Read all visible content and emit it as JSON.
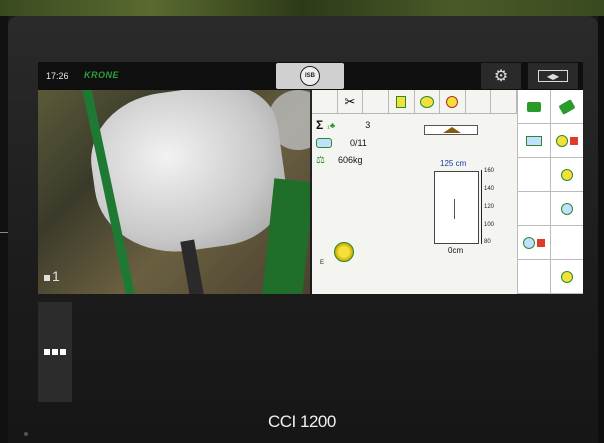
{
  "header": {
    "time": "17:26",
    "brand": "KRONE",
    "isb_label": "ISB",
    "gear_icon": "gear-icon",
    "swap_icon": "swap-screens-icon"
  },
  "camera": {
    "label": "1"
  },
  "isobus": {
    "toolbar": [
      "scissors-icon",
      "net-wrap-icon",
      "bale-counter-a-icon",
      "bale-counter-r-icon",
      "",
      ""
    ],
    "bale_total_label": "Σ",
    "bale_total_value": "3",
    "bale_count": "0/11",
    "weight": "606kg",
    "diameter_label": "125 cm",
    "diameter_ticks": [
      "160",
      "140",
      "120",
      "100",
      "80"
    ],
    "base_label": "0cm",
    "ring_label": "E",
    "colors": {
      "green": "#2a9a2a",
      "yellow": "#f3e13a",
      "red": "#e03a2a",
      "blue": "#1a3aa0"
    }
  },
  "softkeys": [
    "green-block-icon",
    "green-arrow-icon",
    "counter-icon",
    "bale-red-icon",
    "",
    "bale-yellow-icon",
    "",
    "bale-cm-icon",
    "bale-red-2-icon",
    "",
    "",
    "bale-arrow-icon"
  ],
  "footer": {
    "logo": "CCI 1200"
  }
}
